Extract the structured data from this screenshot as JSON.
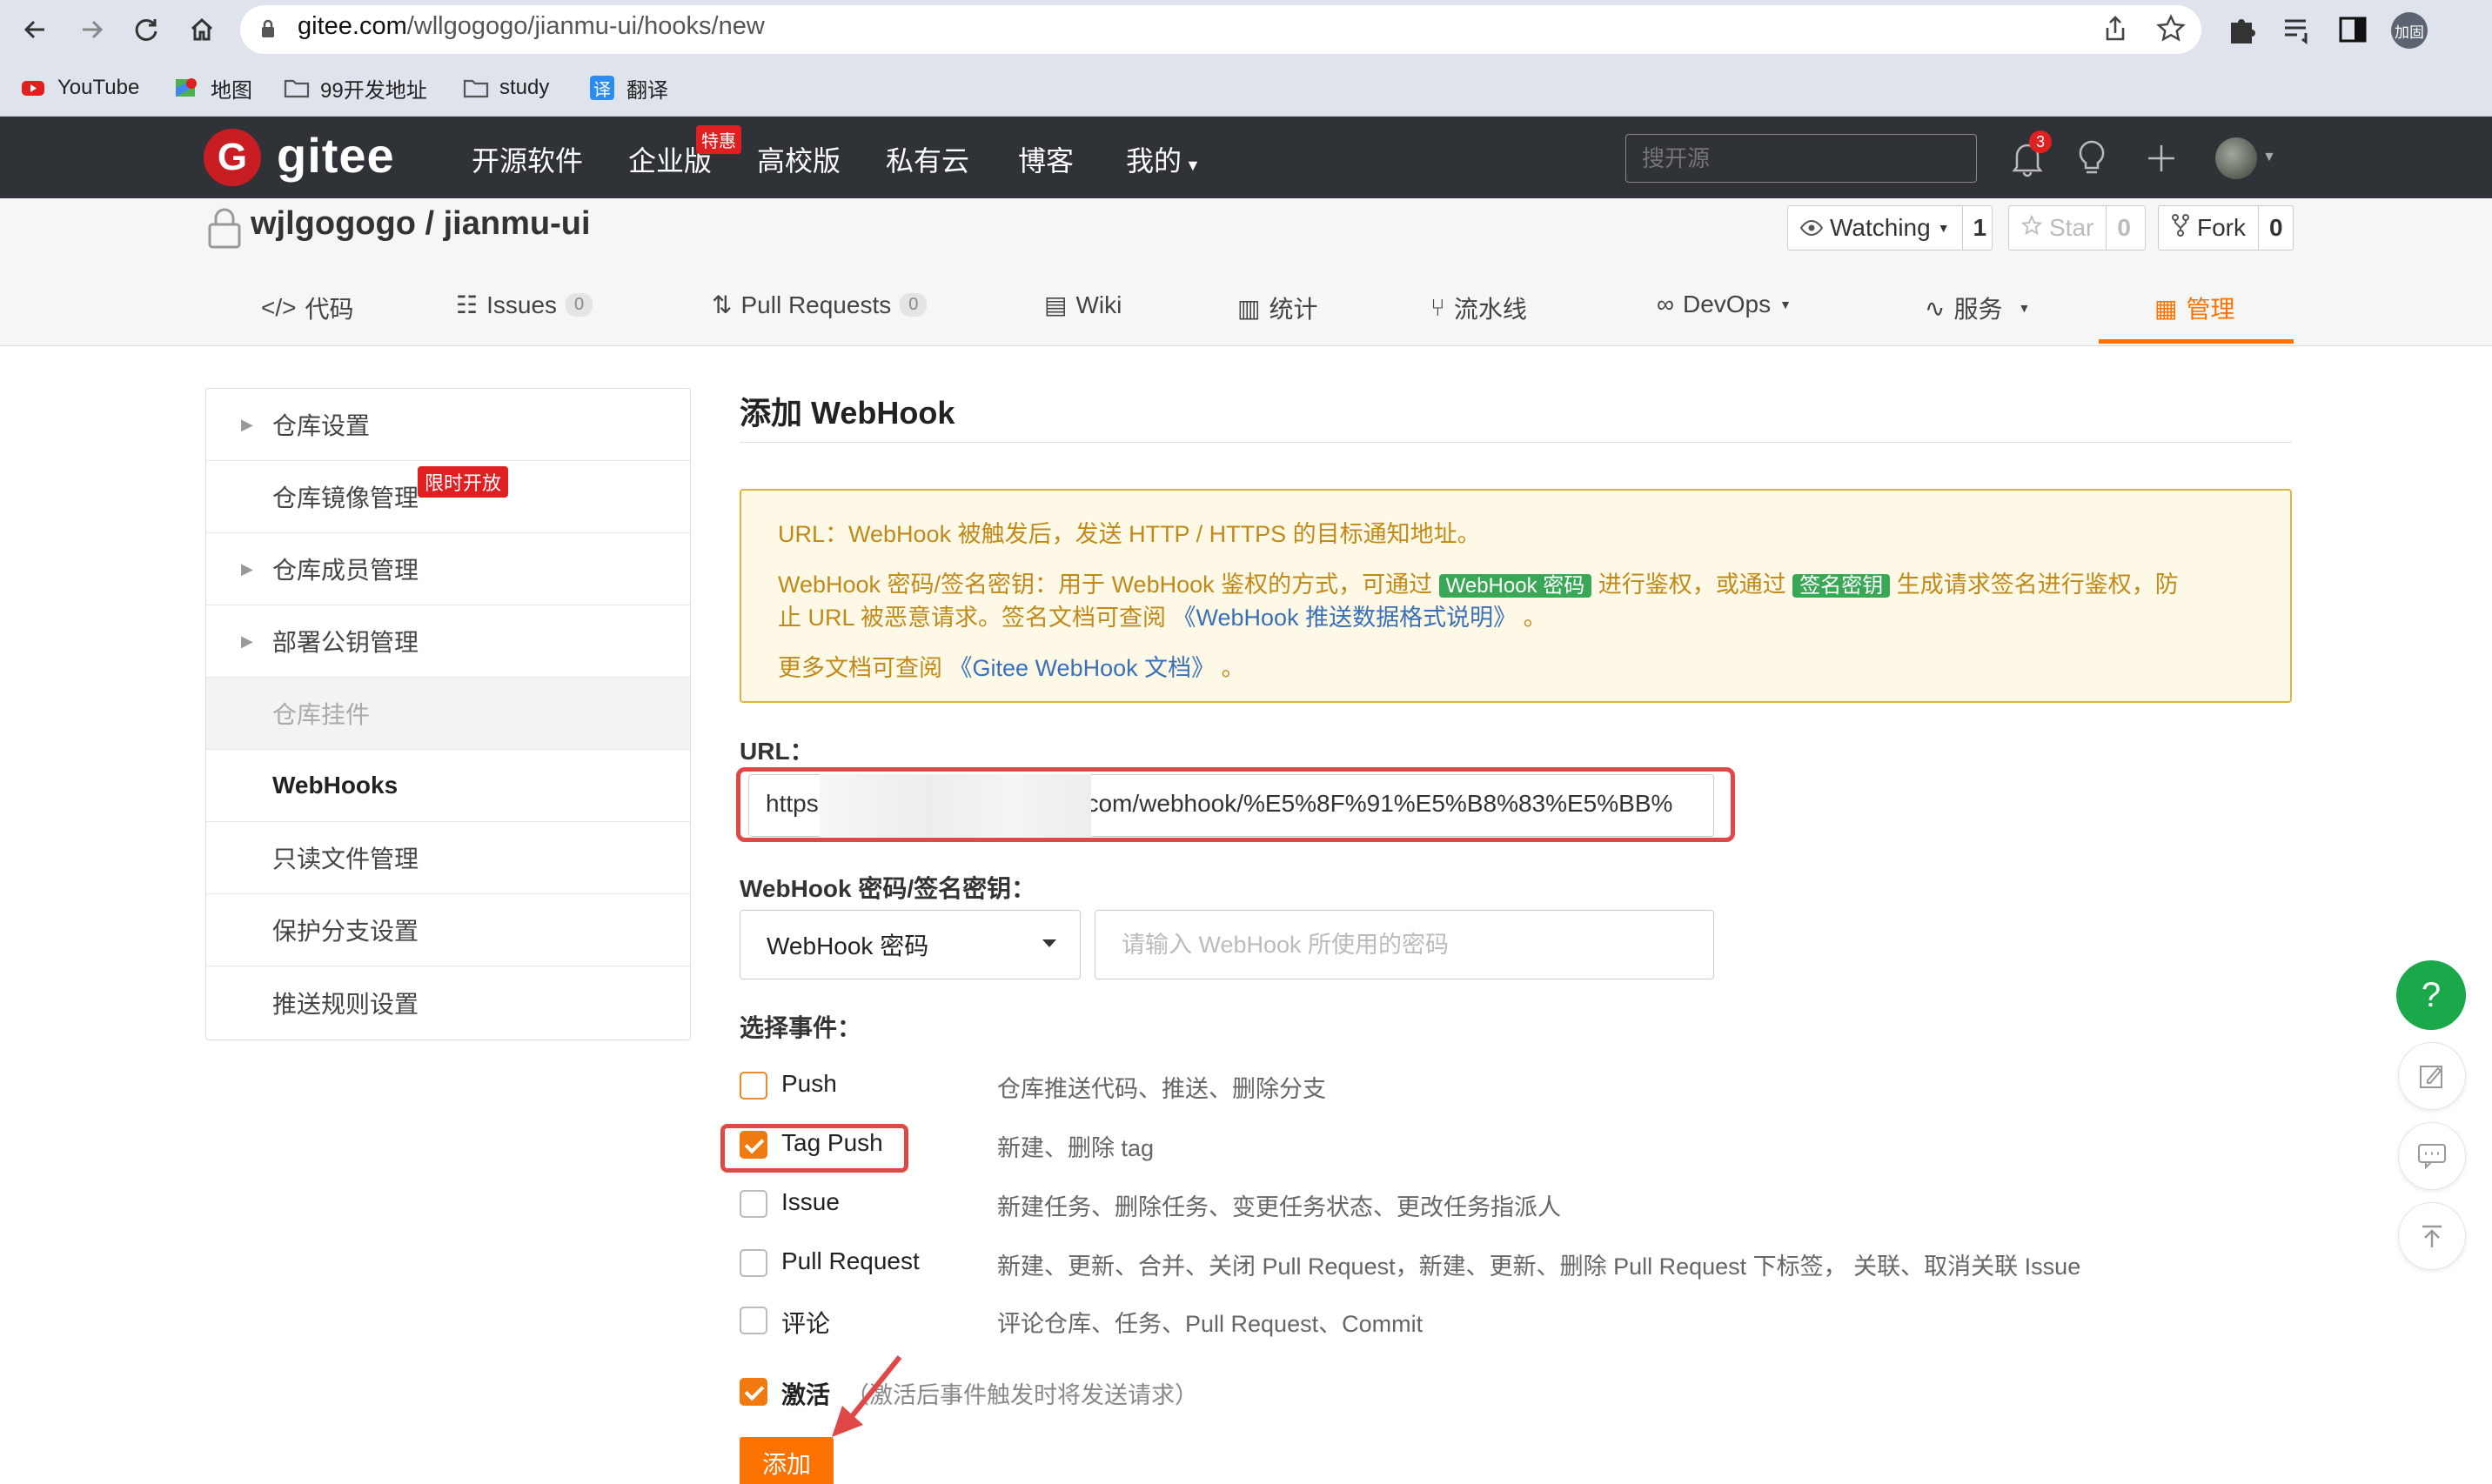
{
  "browser": {
    "url_host": "gitee.com",
    "url_path": "/wllgogogo/jianmu-ui/hooks/new",
    "profile_label": "加固",
    "bookmarks": [
      {
        "label": "YouTube",
        "icon": "youtube-icon"
      },
      {
        "label": "地图",
        "icon": "maps-icon"
      },
      {
        "label": "99开发地址",
        "icon": "folder-icon"
      },
      {
        "label": "study",
        "icon": "folder-icon"
      },
      {
        "label": "翻译",
        "icon": "translate-icon"
      }
    ]
  },
  "header": {
    "logo_letter": "G",
    "logo_text": "gitee",
    "nav": [
      "开源软件",
      "企业版",
      "高校版",
      "私有云",
      "博客",
      "我的"
    ],
    "promo_badge": "特惠",
    "search_placeholder": "搜开源",
    "notification_count": "3"
  },
  "repo": {
    "title": "wjlgogogo / jianmu-ui",
    "watch_label": "Watching",
    "watch_count": "1",
    "star_label": "Star",
    "star_count": "0",
    "fork_label": "Fork",
    "fork_count": "0",
    "tabs": [
      {
        "label": "代码"
      },
      {
        "label": "Issues",
        "count": "0"
      },
      {
        "label": "Pull Requests",
        "count": "0"
      },
      {
        "label": "Wiki"
      },
      {
        "label": "统计"
      },
      {
        "label": "流水线"
      },
      {
        "label": "DevOps"
      },
      {
        "label": "服务"
      },
      {
        "label": "管理"
      }
    ]
  },
  "sidebar": {
    "items": [
      {
        "label": "仓库设置"
      },
      {
        "label": "仓库镜像管理"
      },
      {
        "label": "仓库成员管理"
      },
      {
        "label": "部署公钥管理"
      },
      {
        "label": "仓库挂件"
      },
      {
        "label": "WebHooks"
      },
      {
        "label": "只读文件管理"
      },
      {
        "label": "保护分支设置"
      },
      {
        "label": "推送规则设置"
      }
    ],
    "limited_badge": "限时开放"
  },
  "main": {
    "title": "添加 WebHook",
    "notice": {
      "line1": "URL：WebHook 被触发后，发送 HTTP / HTTPS 的目标通知地址。",
      "line2_a": "WebHook 密码/签名密钥：用于 WebHook 鉴权的方式，可通过 ",
      "line2_tag1": "WebHook 密码",
      "line2_b": " 进行鉴权，或通过 ",
      "line2_tag2": "签名密钥",
      "line2_c": " 生成请求签名进行鉴权，防",
      "line3_a": "止 URL 被恶意请求。签名文档可查阅 ",
      "line3_link": "《WebHook 推送数据格式说明》",
      "line3_b": " 。",
      "line4_a": "更多文档可查阅 ",
      "line4_link": "《Gitee WebHook 文档》",
      "line4_b": " 。"
    },
    "url_label": "URL：",
    "url_value_start": "https",
    "url_value_end": ".com/webhook/%E5%8F%91%E5%B8%83%E5%BB%",
    "secret_label": "WebHook 密码/签名密钥：",
    "secret_type": "WebHook 密码",
    "secret_placeholder": "请输入 WebHook 所使用的密码",
    "events_label": "选择事件：",
    "events": [
      {
        "name": "Push",
        "desc": "仓库推送代码、推送、删除分支",
        "checked": false
      },
      {
        "name": "Tag Push",
        "desc": "新建、删除 tag",
        "checked": true
      },
      {
        "name": "Issue",
        "desc": "新建任务、删除任务、变更任务状态、更改任务指派人",
        "checked": false
      },
      {
        "name": "Pull Request",
        "desc": "新建、更新、合并、关闭 Pull Request，新建、更新、删除 Pull Request 下标签， 关联、取消关联 Issue",
        "checked": false
      },
      {
        "name": "评论",
        "desc": "评论仓库、任务、Pull Request、Commit",
        "checked": false
      }
    ],
    "activate_label": "激活",
    "activate_hint": "（激活后事件触发时将发送请求）",
    "add_button": "添加"
  },
  "floating": {
    "help": "?"
  },
  "colors": {
    "accent": "#fe7300",
    "header_bg": "#2f3338",
    "highlight": "#e04848",
    "notice_bg": "#fef9e6",
    "tag_green": "#3aa757"
  }
}
